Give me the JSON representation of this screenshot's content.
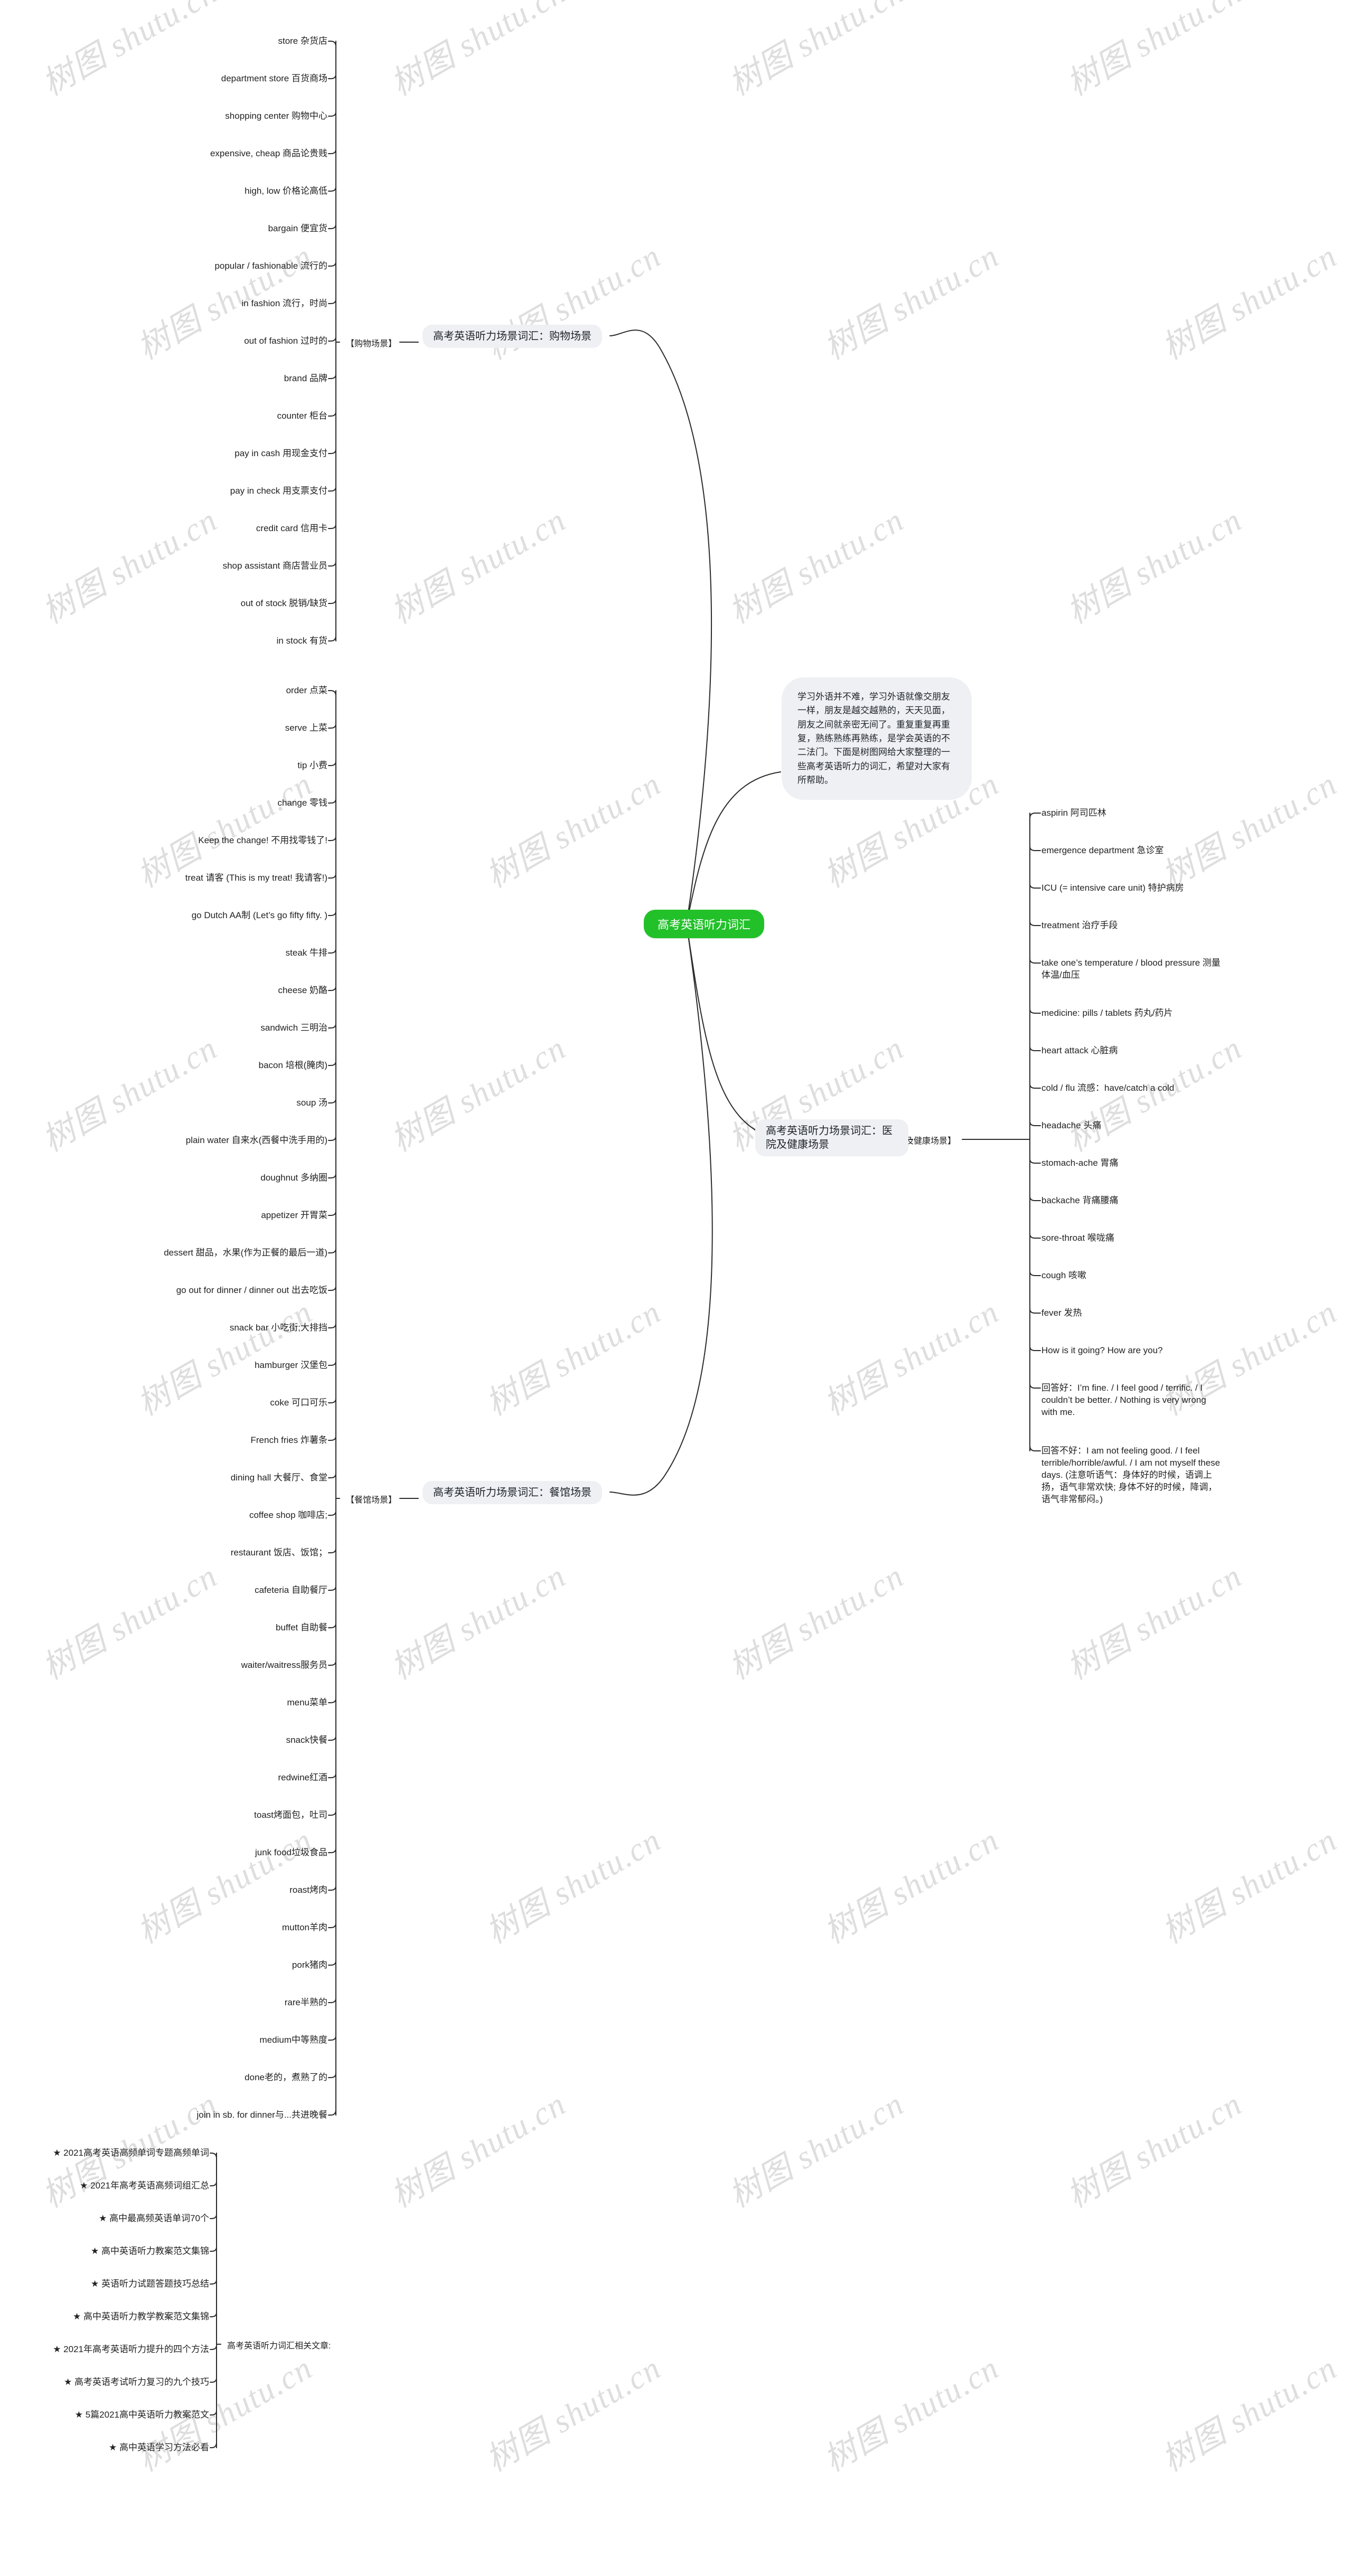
{
  "root": {
    "label": "高考英语听力词汇",
    "color": "#22c12a"
  },
  "note": {
    "text": "学习外语并不难，学习外语就像交朋友一样，朋友是越交越熟的，天天见面，朋友之间就亲密无间了。重复重复再重复，熟练熟练再熟练，是学会英语的不二法门。下面是树图网给大家整理的一些高考英语听力的词汇，希望对大家有所帮助。"
  },
  "watermark": {
    "text": "树图 shutu.cn"
  },
  "branches": [
    {
      "id": "shopping",
      "tag": "【购物场景】",
      "topic": "高考英语听力场景词汇：购物场景",
      "side": "left",
      "items": [
        "store 杂货店",
        "department store 百货商场",
        "shopping center 购物中心",
        "expensive, cheap 商品论贵贱",
        "high, low 价格论高低",
        "bargain 便宜货",
        "popular / fashionable 流行的",
        "in fashion 流行，时尚",
        "out of fashion 过时的",
        "brand 品牌",
        "counter 柜台",
        "pay in cash 用现金支付",
        "pay in check 用支票支付",
        "credit card 信用卡",
        "shop assistant 商店营业员",
        "out of stock 脱销/缺货",
        "in stock 有货"
      ]
    },
    {
      "id": "restaurant",
      "tag": "【餐馆场景】",
      "topic": "高考英语听力场景词汇：餐馆场景",
      "side": "left",
      "items": [
        "order 点菜",
        "serve 上菜",
        "tip 小费",
        "change 零钱",
        "Keep the change! 不用找零钱了!",
        "treat 请客 (This is my treat! 我请客!)",
        "go Dutch AA制 (Let’s go fifty fifty. )",
        "steak 牛排",
        "cheese 奶酪",
        "sandwich 三明治",
        "bacon 培根(腌肉)",
        "soup 汤",
        "plain water 自来水(西餐中洗手用的)",
        "doughnut 多纳圈",
        "appetizer 开胃菜",
        "dessert 甜品，水果(作为正餐的最后一道)",
        "go out for dinner / dinner out 出去吃饭",
        "snack bar 小吃街;大排挡",
        "hamburger 汉堡包",
        "coke 可口可乐",
        "French fries 炸薯条",
        "dining hall 大餐厅、食堂",
        "coffee shop 咖啡店;",
        "restaurant 饭店、饭馆；",
        "cafeteria 自助餐厅",
        "buffet 自助餐",
        "waiter/waitress服务员",
        "menu菜单",
        "snack快餐",
        "redwine红酒",
        "toast烤面包，吐司",
        "junk food垃圾食品",
        "roast烤肉",
        "mutton羊肉",
        "pork猪肉",
        "rare半熟的",
        "medium中等熟度",
        "done老的，煮熟了的",
        "join in sb. for dinner与...共进晚餐"
      ]
    },
    {
      "id": "hospital",
      "tag": "【医院及健康场景】",
      "topic": "高考英语听力场景词汇：医院及健康场景",
      "side": "right",
      "items": [
        "aspirin 阿司匹林",
        "emergence department 急诊室",
        "ICU (= intensive care unit) 特护病房",
        "treatment 治疗手段",
        "take one’s temperature / blood pressure 测量体温/血压",
        "medicine: pills / tablets 药丸/药片",
        "heart attack 心脏病",
        "cold / flu 流感：have/catch a cold",
        "headache 头痛",
        "stomach-ache 胃痛",
        "backache 背痛腰痛",
        "sore-throat 喉咙痛",
        "cough 咳嗽",
        "fever 发热",
        "How is it going? How are you?",
        "回答好：I’m fine. / I feel good / terrific. / I couldn’t be better. / Nothing is very wrong with me.",
        "回答不好：I am not feeling good. / I feel terrible/horrible/awful. / I am not myself these days. (注意听语气：身体好的时候，语调上扬，语气非常欢快; 身体不好的时候，降调，语气非常郁闷。)"
      ]
    },
    {
      "id": "related",
      "tag": "高考英语听力词汇相关文章:",
      "topic": "",
      "side": "left",
      "items": [
        "★ 2021高考英语高频单词专题高频单词",
        "★ 2021年高考英语高频词组汇总",
        "★ 高中最高频英语单词70个",
        "★ 高中英语听力教案范文集锦",
        "★ 英语听力试题答题技巧总结",
        "★ 高中英语听力教学教案范文集锦",
        "★ 2021年高考英语听力提升的四个方法",
        "★ 高考英语考试听力复习的九个技巧",
        "★ 5篇2021高中英语听力教案范文",
        "★ 高中英语学习方法必看"
      ]
    }
  ]
}
